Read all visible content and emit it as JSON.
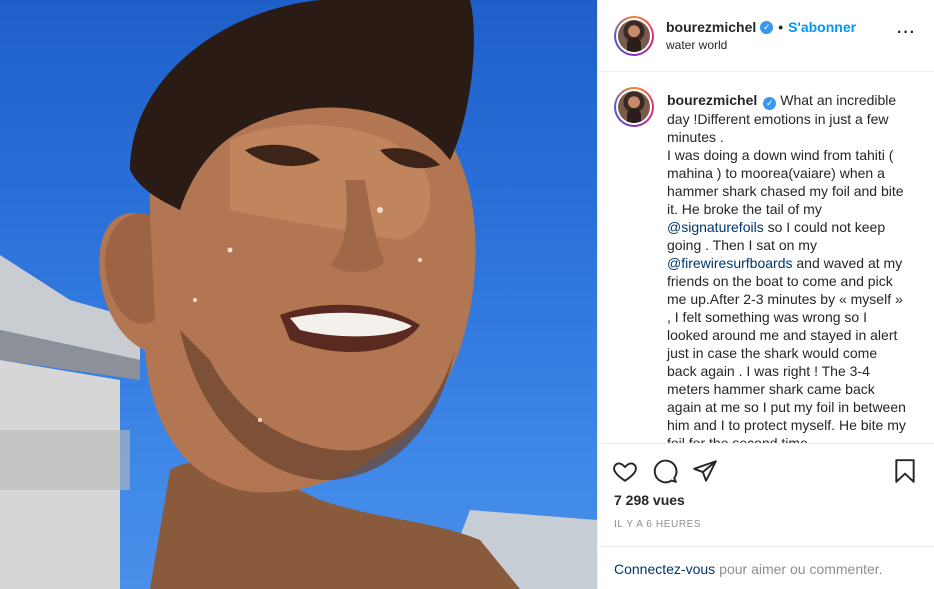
{
  "post": {
    "username": "bourezmichel",
    "follow_label": "S'abonner",
    "location": "water world",
    "more_icon": "more-options-icon"
  },
  "caption": {
    "username": "bourezmichel",
    "text_1": "What an incredible day !Different emotions in just a few minutes .\nI was doing a down wind from tahiti ( mahina ) to moorea(vaiare) when a hammer shark chased my foil and bite it. He broke the tail of my ",
    "mention_1": "@signaturefoils",
    "text_2": " so I could not keep going . Then I sat on my ",
    "mention_2": "@firewiresurfboards",
    "text_3": " and waved at my friends on the boat to come and pick me up.After 2-3 minutes by « myself » , I felt something was wrong so I looked around me and stayed in alert just in case the shark would come back again . I was right ! The 3-4 meters hammer shark came back again at me so I put my foil in between him and I to protect myself. He bite my foil for the second time"
  },
  "actions": {
    "icons": [
      "heart-icon",
      "comment-icon",
      "share-icon",
      "bookmark-icon"
    ],
    "views": "7 298 vues",
    "time": "IL Y A 6 HEURES"
  },
  "login": {
    "link": "Connectez-vous",
    "rest": "pour aimer ou commenter."
  },
  "colors": {
    "link_blue": "#0095f6",
    "mention": "#00376b",
    "verified": "#3897f0",
    "muted": "#8e8e8e"
  }
}
